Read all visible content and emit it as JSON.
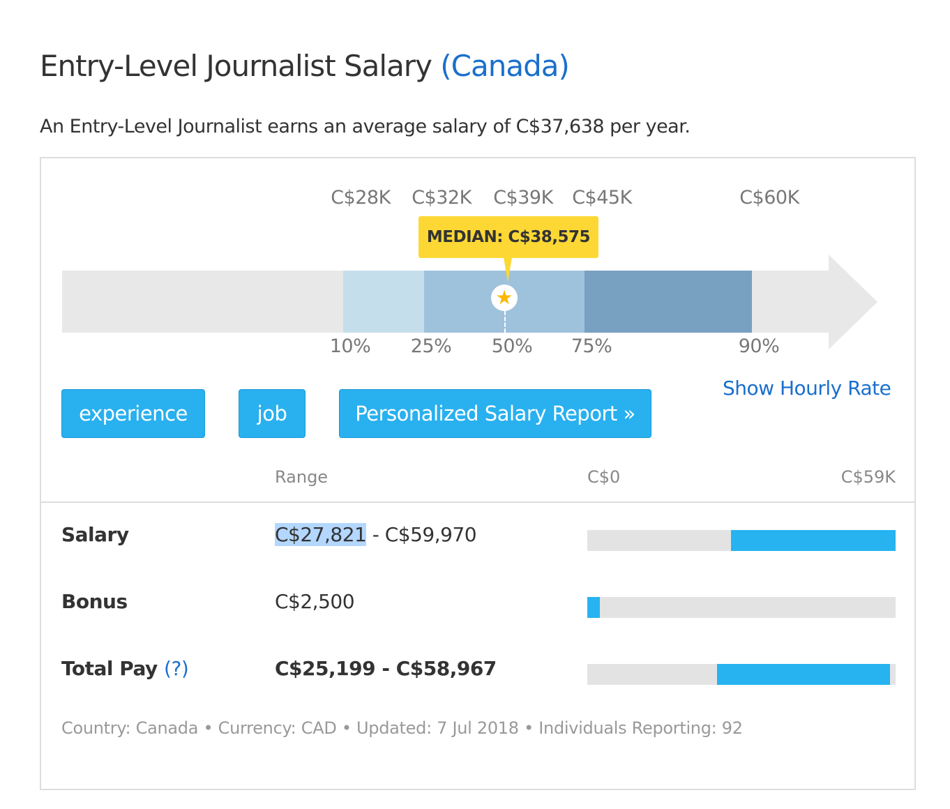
{
  "header": {
    "title": "Entry-Level Journalist Salary",
    "country": "(Canada)",
    "subtitle": "An Entry-Level Journalist earns an average salary of C$37,638 per year."
  },
  "percentiles": {
    "values": [
      {
        "pct": "10%",
        "amount": "C$28K"
      },
      {
        "pct": "25%",
        "amount": "C$32K"
      },
      {
        "pct": "50%",
        "amount": "C$39K"
      },
      {
        "pct": "75%",
        "amount": "C$45K"
      },
      {
        "pct": "90%",
        "amount": "C$60K"
      }
    ],
    "median_label": "MEDIAN: C$38,575",
    "segment_colors": [
      "#c5deec",
      "#9fc2dc",
      "#78a0c1"
    ],
    "track_color": "#e8e8e8",
    "median_icon": "star-icon"
  },
  "actions": {
    "experience": "experience",
    "job": "job",
    "report": "Personalized Salary Report »",
    "hourly": "Show Hourly Rate"
  },
  "table": {
    "range_header": "Range",
    "scale_min": "C$0",
    "scale_max": "C$59K",
    "rows": [
      {
        "label": "Salary",
        "low": "C$27,821",
        "sep": " - ",
        "high": "C$59,970",
        "fill_start": 0.466,
        "fill_end": 1.0
      },
      {
        "label": "Bonus",
        "value": "C$2,500",
        "fill_start": 0.0,
        "fill_end": 0.04
      },
      {
        "label": "Total Pay",
        "help": "?",
        "value": "C$25,199 - C$58,967",
        "fill_start": 0.42,
        "fill_end": 0.982
      }
    ],
    "accent": "#26b3f0"
  },
  "footer": "Country: Canada • Currency: CAD • Updated: 7 Jul 2018 • Individuals Reporting: 92"
}
